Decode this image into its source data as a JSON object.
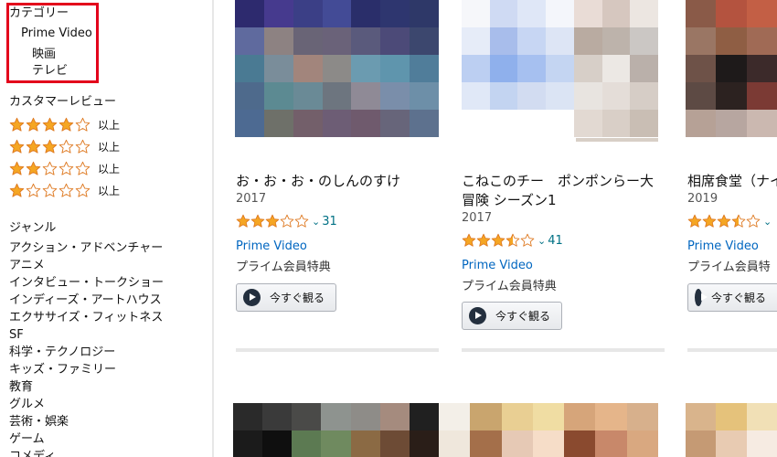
{
  "sidebar": {
    "category": {
      "title": "カテゴリー",
      "prime": "Prime Video",
      "sub": [
        "映画",
        "テレビ"
      ]
    },
    "reviews": {
      "title": "カスタマーレビュー",
      "rows": [
        {
          "stars": 4,
          "suffix": "以上"
        },
        {
          "stars": 3,
          "suffix": "以上"
        },
        {
          "stars": 2,
          "suffix": "以上"
        },
        {
          "stars": 1,
          "suffix": "以上"
        }
      ]
    },
    "genre": {
      "title": "ジャンル",
      "items": [
        "アクション・アドベンチャー",
        "アニメ",
        "インタビュー・トークショー",
        "インディーズ・アートハウス",
        "エクササイズ・フィットネス",
        "SF",
        "科学・テクノロジー",
        "キッズ・ファミリー",
        "教育",
        "グルメ",
        "芸術・娯楽",
        "ゲーム",
        "コメディ"
      ]
    }
  },
  "products": [
    {
      "title": "お・お・お・のしんのすけ",
      "year": "2017",
      "rating": 3,
      "count": "31",
      "link": "Prime Video",
      "benefit": "プライム会員特典",
      "button": "今すぐ観る"
    },
    {
      "title_line1": "こねこのチー　ポンポンらー大",
      "title_line2": "冒険 シーズン1",
      "year": "2017",
      "rating": 3.5,
      "count": "41",
      "link": "Prime Video",
      "benefit": "プライム会員特典",
      "button": "今すぐ観る"
    },
    {
      "title": "相席食堂（ナイ",
      "year": "2019",
      "rating": 3.5,
      "count": "",
      "link": "Prime Video",
      "benefit": "プライム会員特",
      "button": "今すぐ観る"
    }
  ],
  "colors": {
    "star": "#f5a623",
    "link": "#0066c0",
    "highlight_box": "#e3001b"
  }
}
